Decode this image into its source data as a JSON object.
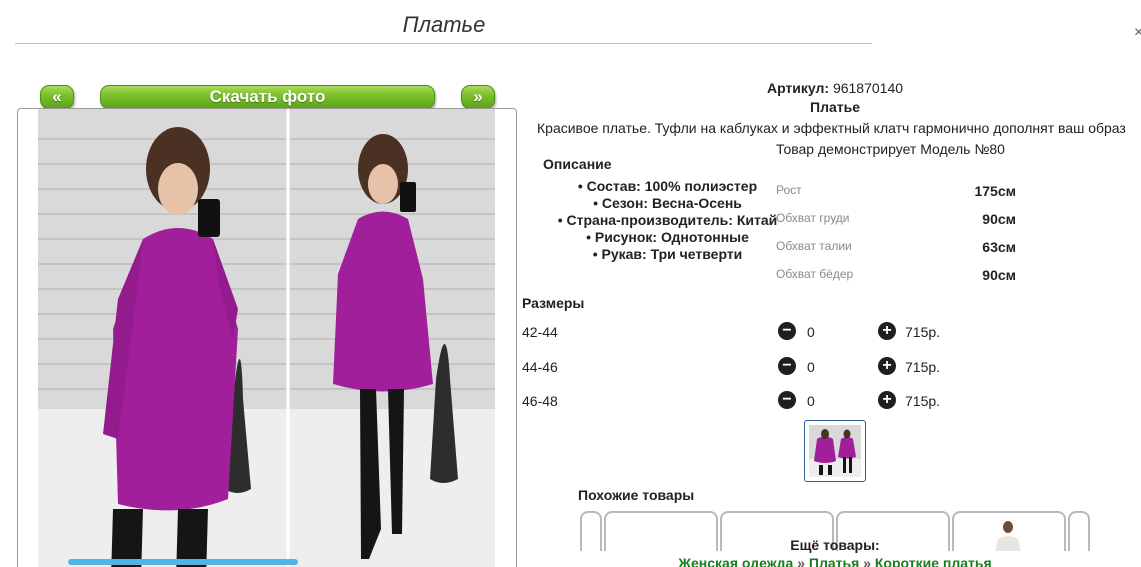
{
  "page": {
    "title": "Платье",
    "close": "×"
  },
  "gallery": {
    "prev_label": "«",
    "next_label": "»",
    "download_label": "Скачать фото"
  },
  "product": {
    "article_label": "Артикул:",
    "article_value": "961870140",
    "name": "Платье",
    "description": "Красивое платье. Туфли на каблуках и эффектный клатч гармонично дополнят ваш образ",
    "model_note": "Товар демонстрирует Модель №80",
    "description_heading": "Описание",
    "specs": [
      "Состав: 100% полиэстер",
      "Сезон: Весна-Осень",
      "Страна-производитель: Китай",
      "Рисунок: Однотонные",
      "Рукав: Три четверти"
    ],
    "measurements": [
      {
        "label": "Рост",
        "value": "175см"
      },
      {
        "label": "Обхват груди",
        "value": "90см"
      },
      {
        "label": "Обхват талии",
        "value": "63см"
      },
      {
        "label": "Обхват бёдер",
        "value": "90см"
      }
    ]
  },
  "sizes": {
    "heading": "Размеры",
    "minus_icon": "minus-circle-icon",
    "plus_icon": "plus-circle-icon",
    "rows": [
      {
        "size": "42-44",
        "qty": "0",
        "price": "715р."
      },
      {
        "size": "44-46",
        "qty": "0",
        "price": "715р."
      },
      {
        "size": "46-48",
        "qty": "0",
        "price": "715р."
      }
    ]
  },
  "similar": {
    "heading": "Похожие товары"
  },
  "more": {
    "heading": "Ещё товары:",
    "crumbs": [
      "Женская одежда",
      "Платья",
      "Короткие платья"
    ],
    "separator": "»"
  },
  "colors": {
    "green_button": "#79be2b",
    "dress": "#a21f9c",
    "link_green": "#17801a",
    "thumb_border": "#2c5d94"
  }
}
